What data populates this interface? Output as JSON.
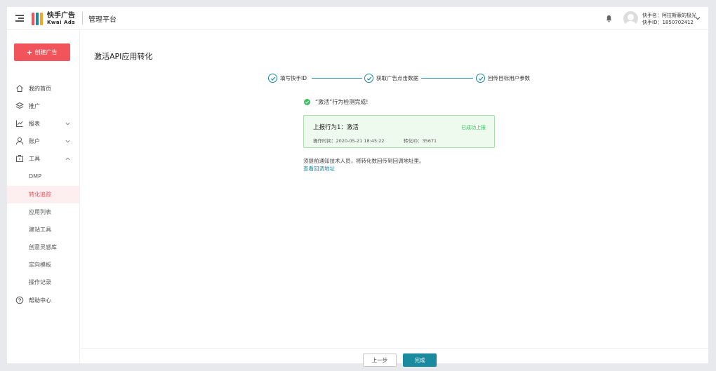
{
  "header": {
    "logo_cn": "快手广告",
    "logo_en": "Kwai Ads",
    "platform": "管理平台",
    "user_name_line": "快手名：阿拉斯蔽的极光",
    "user_id_line": "快手ID：1850702412",
    "icons": {
      "menu": "hamburger-icon",
      "notify": "bell-icon",
      "dropdown": "chevron-down-icon"
    }
  },
  "sidebar": {
    "create_label": "创建广告",
    "items": [
      {
        "label": "我的首页",
        "icon": "home-icon"
      },
      {
        "label": "推广",
        "icon": "layers-icon"
      },
      {
        "label": "报表",
        "icon": "chart-icon"
      },
      {
        "label": "账户",
        "icon": "user-icon"
      },
      {
        "label": "工具",
        "icon": "toolbox-icon"
      }
    ],
    "tool_subitems": [
      "DMP",
      "转化追踪",
      "应用列表",
      "建站工具",
      "创意灵感库",
      "定向模板",
      "操作记录"
    ],
    "help_label": "帮助中心",
    "active_subitem": "转化追踪"
  },
  "main": {
    "title": "激活API应用转化",
    "steps": [
      "填写快手ID",
      "获取广告点击数据",
      "回传目标用户参数"
    ],
    "detect_text": "“激活”行为检测完成!",
    "result": {
      "title": "上报行为1：激活",
      "status": "已成功上报",
      "time": "操作时间：2020-05-21 18:45:22",
      "conversion_id": "转化ID：35671"
    },
    "notice": "须提前通知技术人员，将转化数回传到回调地址里。",
    "link": "查看回调地址",
    "prev_button": "上一步",
    "done_button": "完成"
  },
  "colors": {
    "brand_red": "#f2545b",
    "teal": "#1a8a9e",
    "success": "#3cbf62"
  }
}
